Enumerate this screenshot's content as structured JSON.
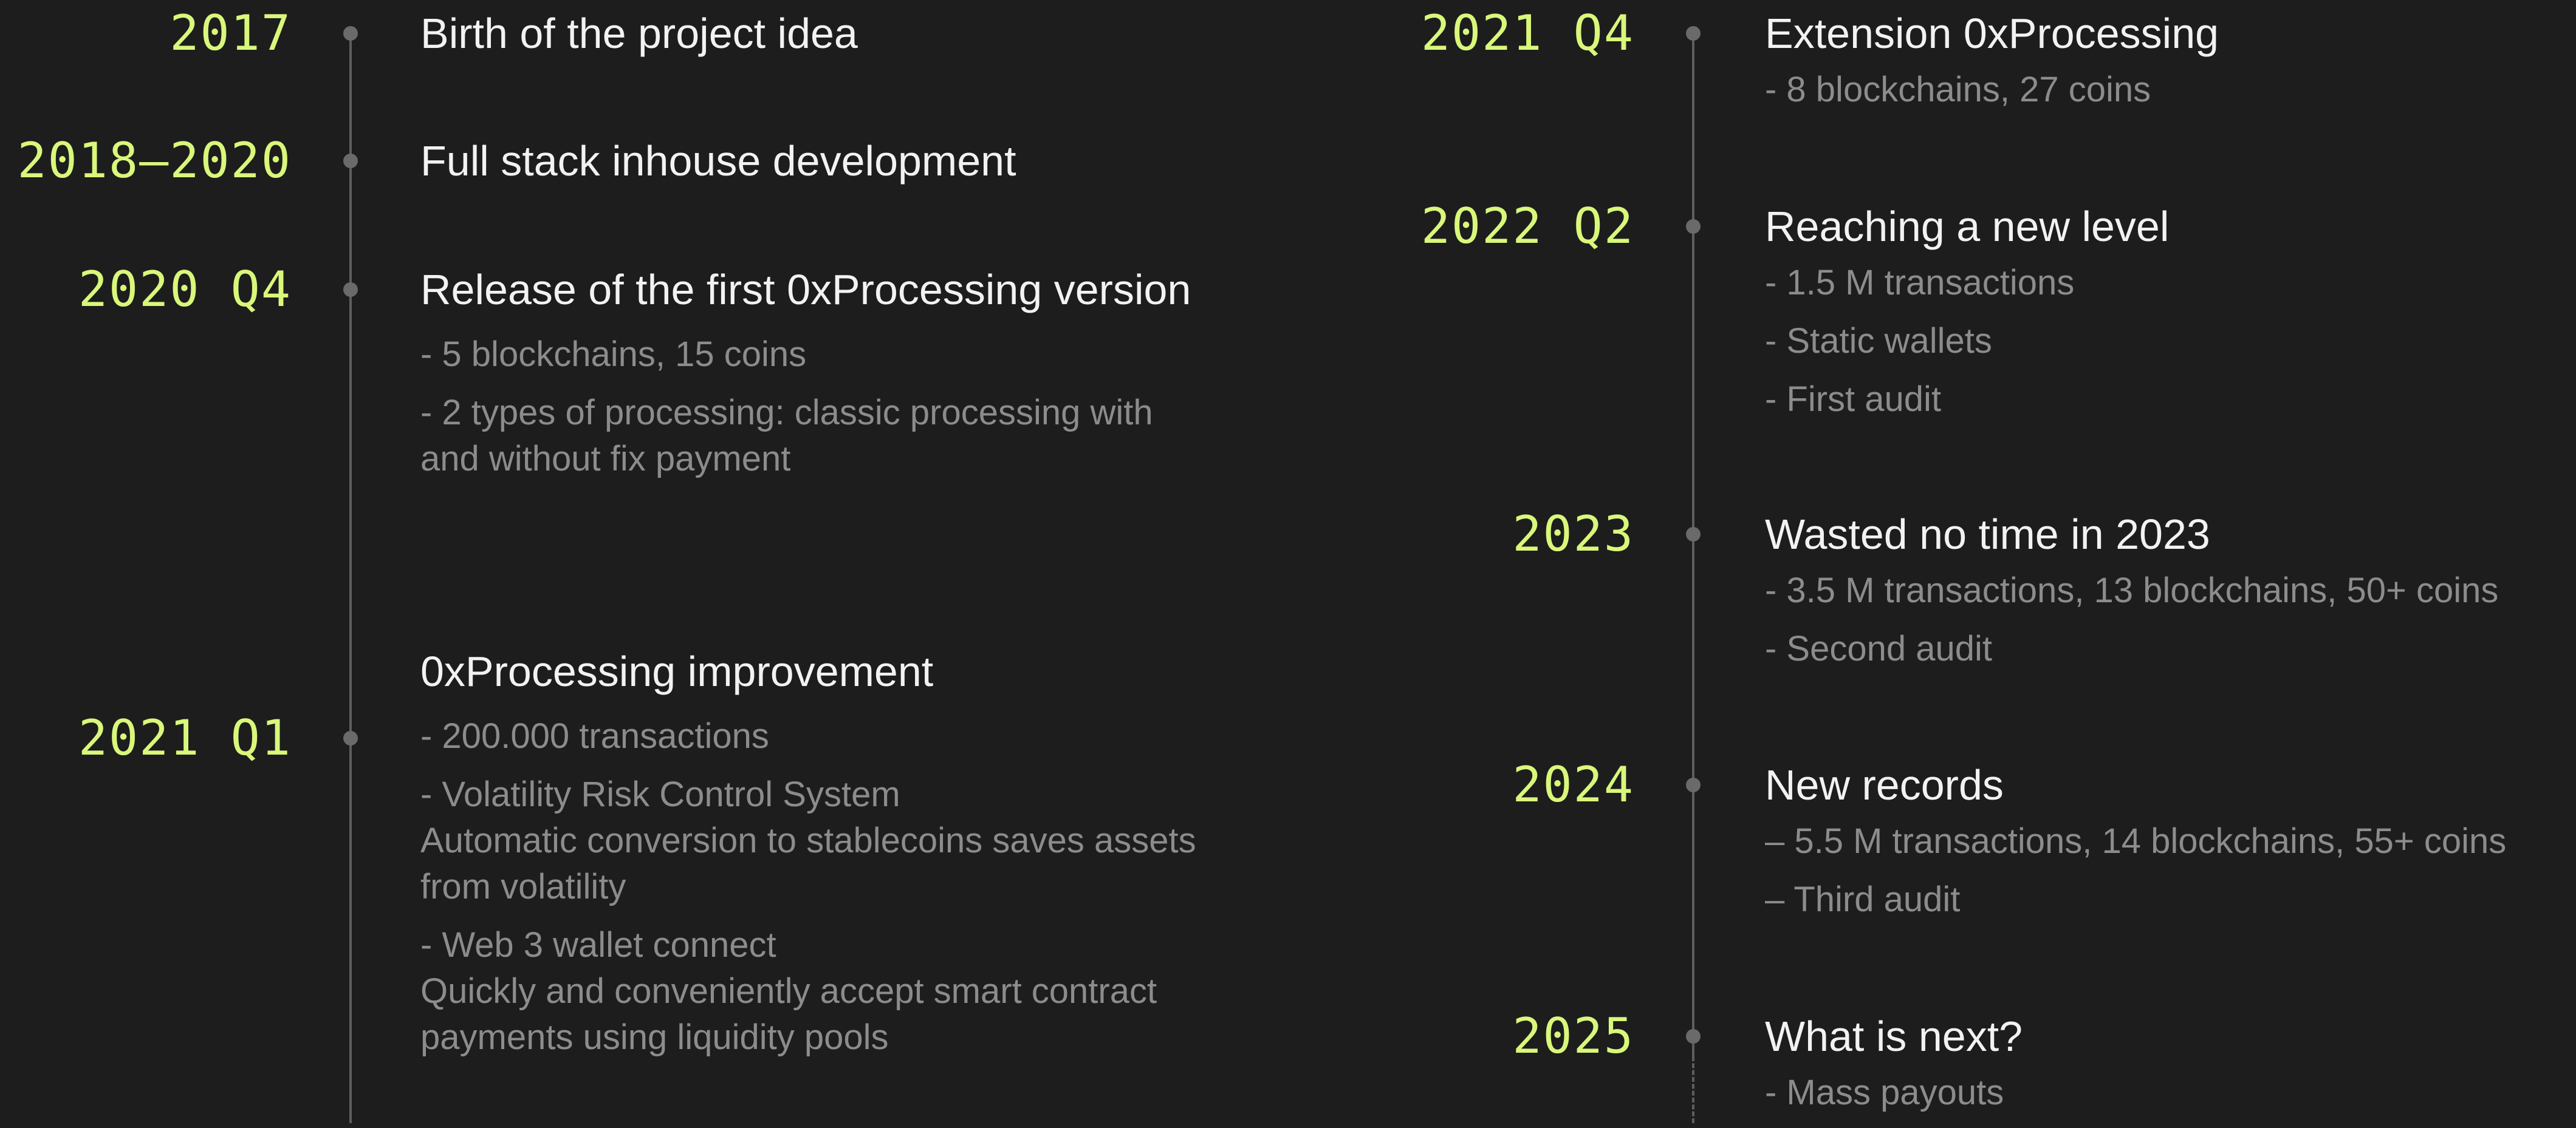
{
  "left": [
    {
      "year": "2017",
      "title": "Birth of the project idea",
      "details": []
    },
    {
      "year": "2018–2020",
      "title": "Full stack inhouse development",
      "details": []
    },
    {
      "year": "2020 Q4",
      "title": "Release of the first 0xProcessing version",
      "details": [
        "- 5 blockchains, 15 coins",
        "- 2 types of processing: classic processing with and without fix payment"
      ]
    },
    {
      "year": "2021 Q1",
      "title": "0xProcessing improvement",
      "details": [
        "- 200.000 transactions",
        "- Volatility Risk Control System\nAutomatic conversion to stablecoins saves assets from volatility",
        "- Web 3 wallet connect\nQuickly and conveniently accept smart contract payments using liquidity pools"
      ]
    }
  ],
  "right": [
    {
      "year": "2021 Q4",
      "title": "Extension 0xProcessing",
      "details": [
        "- 8 blockchains, 27 coins"
      ]
    },
    {
      "year": "2022 Q2",
      "title": "Reaching a new level",
      "details": [
        "- 1.5 M transactions",
        "- Static wallets",
        "- First audit"
      ]
    },
    {
      "year": "2023",
      "title": "Wasted no time in 2023",
      "details": [
        "- 3.5 M transactions, 13 blockchains, 50+ coins",
        "- Second audit"
      ]
    },
    {
      "year": "2024",
      "title": "New records",
      "details": [
        "– 5.5 M transactions, 14 blockchains, 55+ coins",
        "– Third audit"
      ]
    },
    {
      "year": "2025",
      "title": "What is next?",
      "details": [
        "- Mass payouts"
      ]
    }
  ]
}
